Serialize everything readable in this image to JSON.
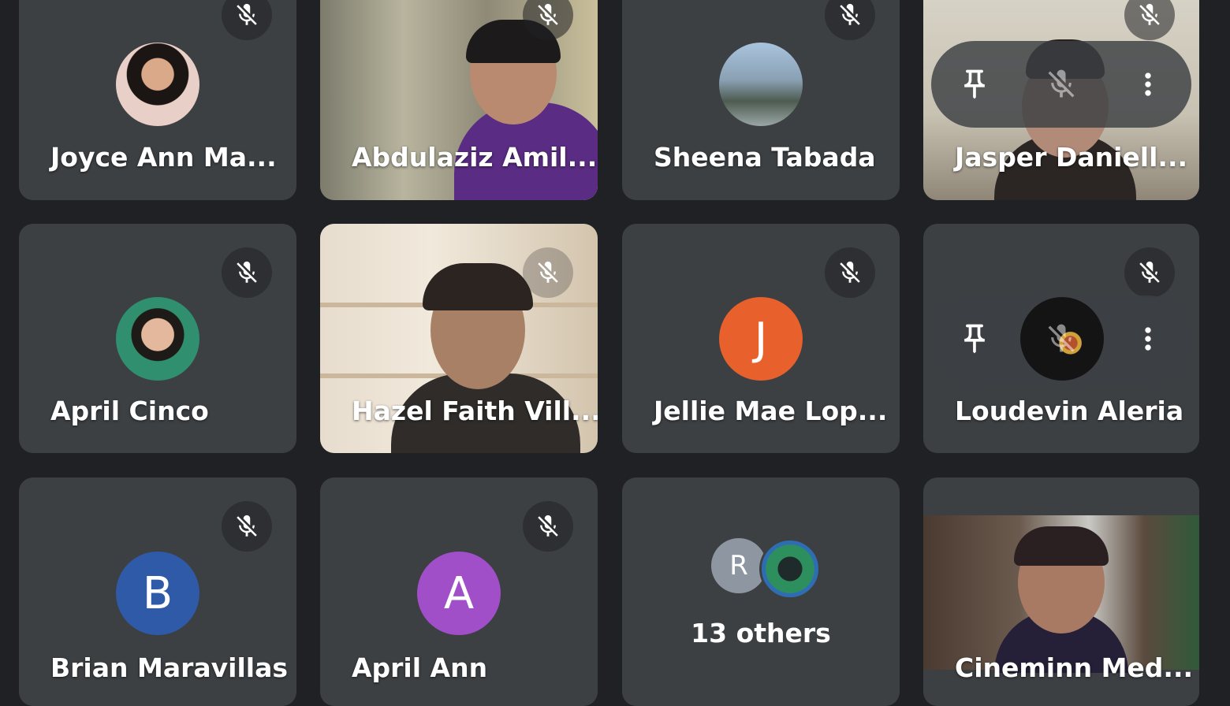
{
  "colors": {
    "background": "#202124",
    "tile": "#3c4043",
    "avatar_j": "#e8602c",
    "avatar_b": "#2e5aa7",
    "avatar_a": "#a14fc8",
    "avatar_r": "#8e97a1"
  },
  "participants": [
    {
      "name": "Joyce Ann Ma...",
      "muted": true,
      "avatar": "photo"
    },
    {
      "name": "Abdulaziz Amil...",
      "muted": true,
      "avatar": "video"
    },
    {
      "name": "Sheena Tabada",
      "muted": true,
      "avatar": "photo"
    },
    {
      "name": "Jasper Daniell...",
      "muted": true,
      "avatar": "video"
    },
    {
      "name": "April Cinco",
      "muted": true,
      "avatar": "photo"
    },
    {
      "name": "Hazel Faith Vill...",
      "muted": true,
      "avatar": "video"
    },
    {
      "name": "Jellie Mae Lop...",
      "muted": true,
      "avatar": "J"
    },
    {
      "name": "Loudevin Aleria",
      "muted": true,
      "avatar": "photo"
    },
    {
      "name": "Brian Maravillas",
      "muted": true,
      "avatar": "B"
    },
    {
      "name": "April Ann",
      "muted": true,
      "avatar": "A"
    },
    {
      "name": "Cineminn Med...",
      "muted": false,
      "avatar": "video"
    }
  ],
  "others": {
    "label": "13 others",
    "initial": "R"
  },
  "icons": {
    "mute": "mic-off-icon",
    "pin": "pin-icon",
    "more": "more-vert-icon"
  }
}
